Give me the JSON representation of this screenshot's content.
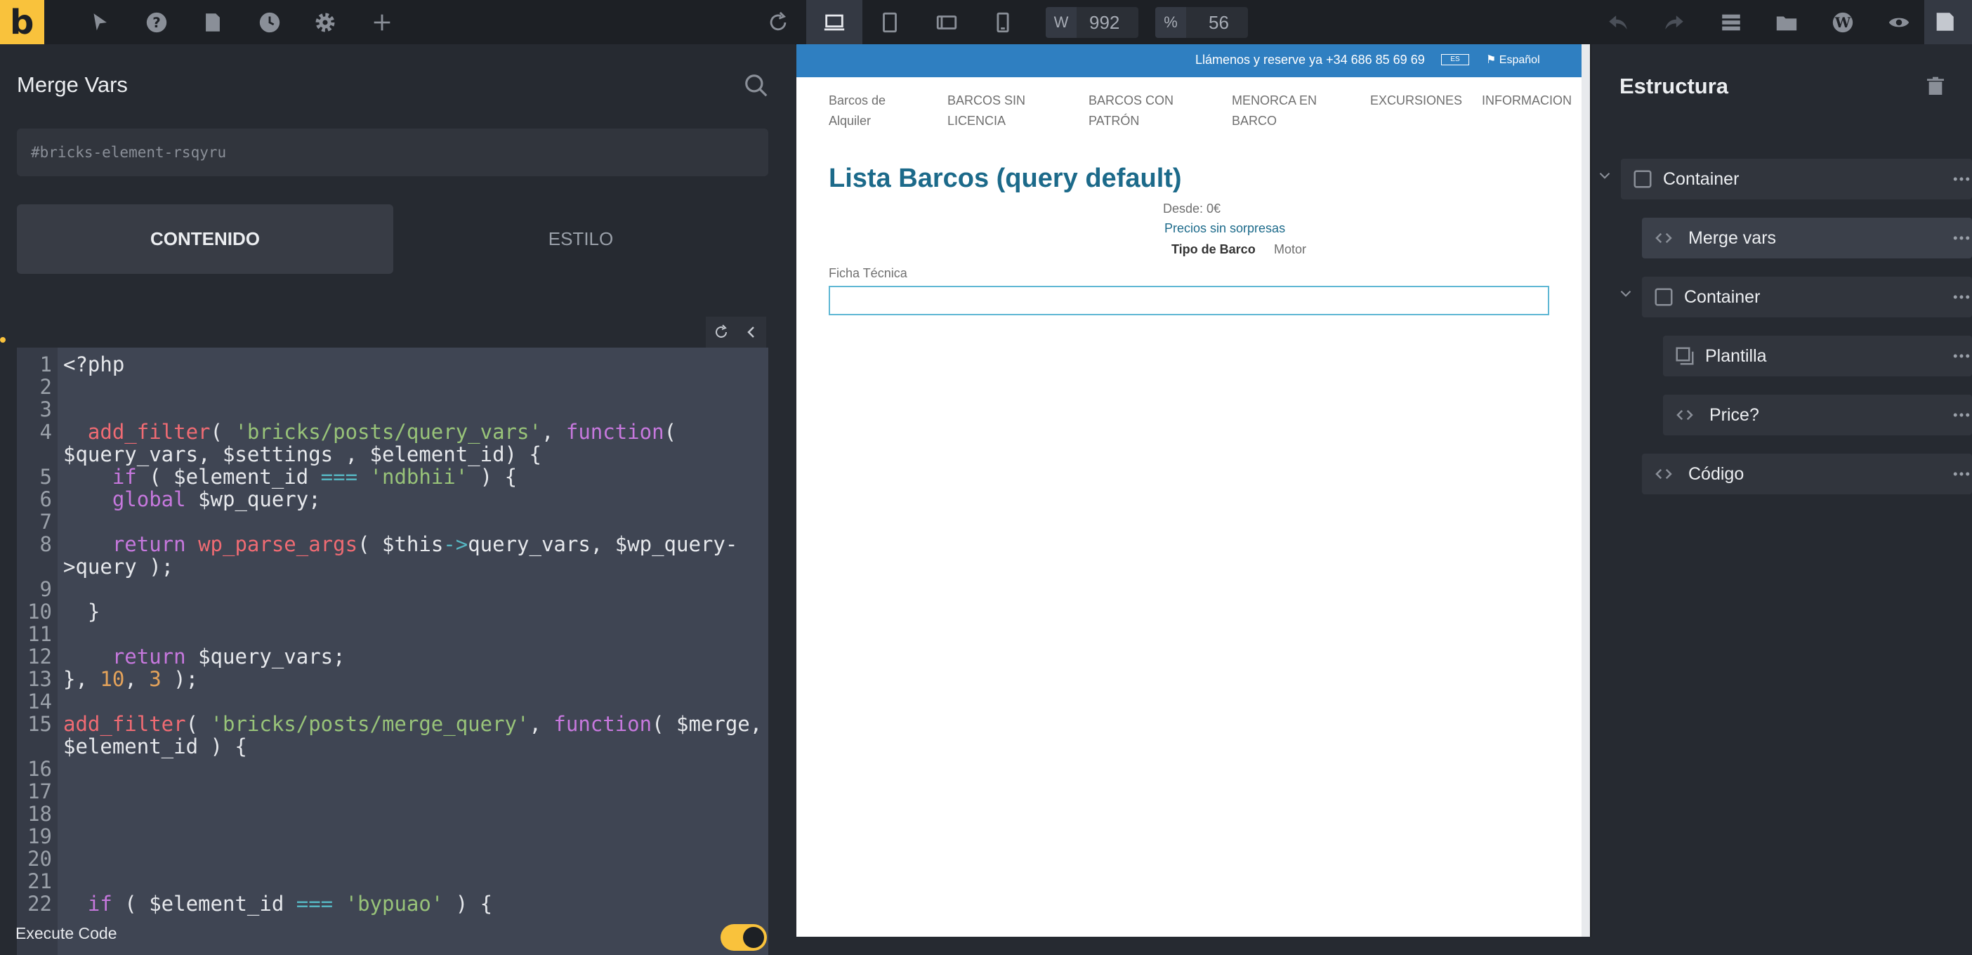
{
  "toolbar": {
    "logo": "b",
    "width_label": "W",
    "width_value": "992",
    "zoom_label": "%",
    "zoom_value": "56"
  },
  "left_panel": {
    "title": "Merge Vars",
    "selector": "#bricks-element-rsqyru",
    "tab_content": "CONTENIDO",
    "tab_style": "ESTILO",
    "execute_label": "Execute Code",
    "execute_enabled": true,
    "code_lines": [
      {
        "n": "1",
        "text": "<?php"
      },
      {
        "n": "2",
        "text": ""
      },
      {
        "n": "3",
        "text": ""
      },
      {
        "n": "4",
        "text": "  add_filter( 'bricks/posts/query_vars', function("
      },
      {
        "n": "",
        "text": "$query_vars, $settings , $element_id) {"
      },
      {
        "n": "5",
        "text": "    if ( $element_id === 'ndbhii' ) {"
      },
      {
        "n": "6",
        "text": "    global $wp_query;"
      },
      {
        "n": "7",
        "text": ""
      },
      {
        "n": "8",
        "text": "    return wp_parse_args( $this->query_vars, $wp_query-"
      },
      {
        "n": "",
        "text": ">query );"
      },
      {
        "n": "9",
        "text": ""
      },
      {
        "n": "10",
        "text": "  }"
      },
      {
        "n": "11",
        "text": ""
      },
      {
        "n": "12",
        "text": "    return $query_vars;"
      },
      {
        "n": "13",
        "text": "}, 10, 3 );"
      },
      {
        "n": "14",
        "text": ""
      },
      {
        "n": "15",
        "text": "add_filter( 'bricks/posts/merge_query', function( $merge,"
      },
      {
        "n": "",
        "text": "$element_id ) {"
      },
      {
        "n": "16",
        "text": ""
      },
      {
        "n": "17",
        "text": ""
      },
      {
        "n": "18",
        "text": ""
      },
      {
        "n": "19",
        "text": ""
      },
      {
        "n": "20",
        "text": ""
      },
      {
        "n": "21",
        "text": ""
      },
      {
        "n": "22",
        "text": "  if ( $element_id === 'bypuao' ) {"
      }
    ]
  },
  "preview": {
    "top_phone": "Llámenos y reserve ya +34 686 85 69 69",
    "top_badge": "ES",
    "top_language": "Español",
    "nav": [
      {
        "line1": "Barcos de",
        "line2": "Alquiler"
      },
      {
        "line1": "BARCOS SIN",
        "line2": "LICENCIA"
      },
      {
        "line1": "BARCOS CON",
        "line2": "PATRÓN"
      },
      {
        "line1": "MENORCA EN",
        "line2": "BARCO"
      },
      {
        "line1": "EXCURSIONES",
        "line2": ""
      },
      {
        "line1": "INFORMACION",
        "line2": ""
      }
    ],
    "heading": "Lista Barcos (query default)",
    "price": "Desde: 0€",
    "tagline": "Precios sin sorpresas",
    "tipo_label": "Tipo de Barco",
    "tipo_value": "Motor",
    "ficha": "Ficha Técnica"
  },
  "structure": {
    "title": "Estructura",
    "nodes": [
      {
        "label": "Container",
        "icon": "container-icon"
      },
      {
        "label": "Merge vars",
        "icon": "code-icon"
      },
      {
        "label": "Container",
        "icon": "container-icon"
      },
      {
        "label": "Plantilla",
        "icon": "template-icon"
      },
      {
        "label": "Price?",
        "icon": "code-icon"
      },
      {
        "label": "Código",
        "icon": "code-icon"
      }
    ]
  },
  "colors": {
    "accent": "#f9c23c",
    "preview_blue": "#2f7fc1",
    "heading_blue": "#1c6a8a"
  }
}
